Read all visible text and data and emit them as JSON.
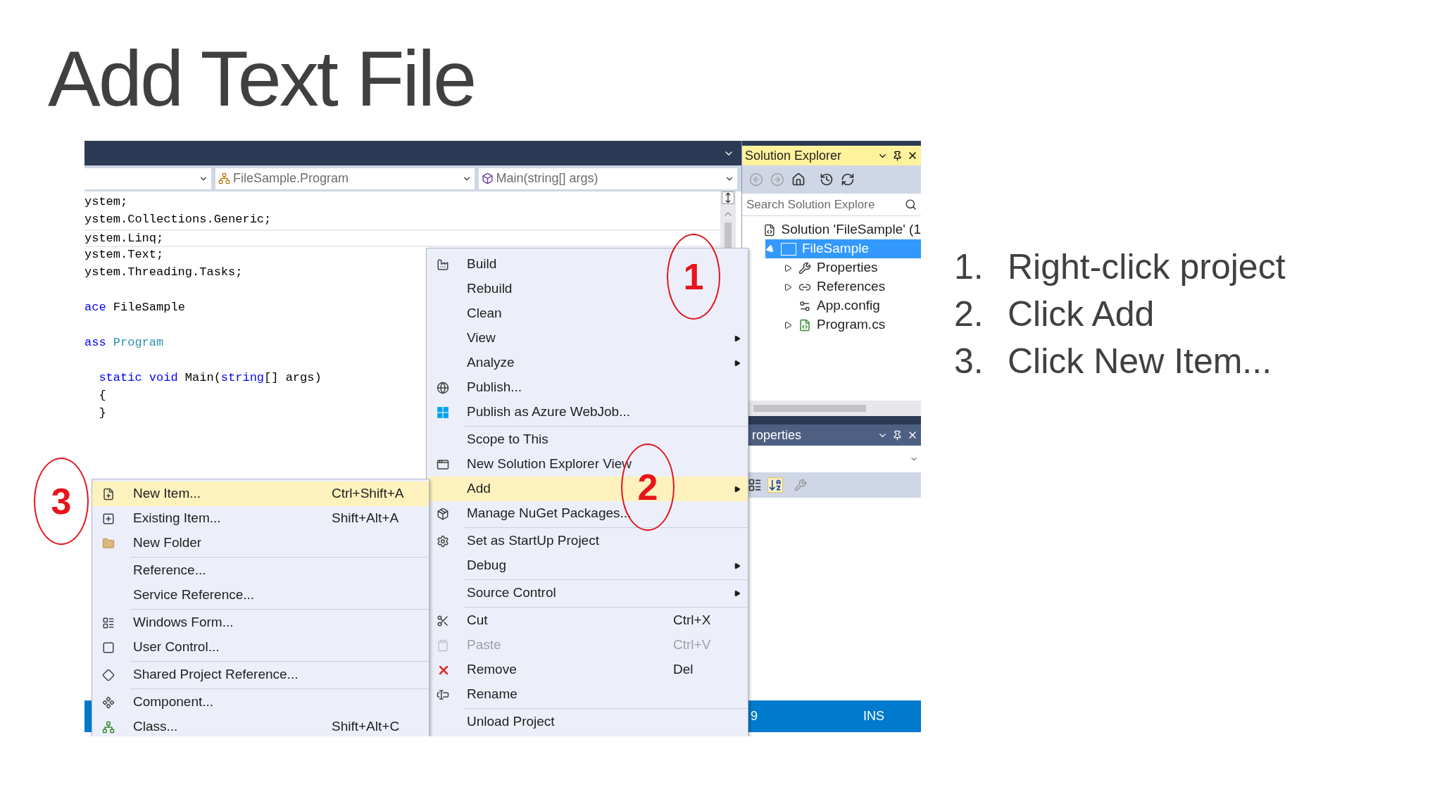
{
  "slide": {
    "title": "Add Text File",
    "steps": [
      {
        "number": "1.",
        "text": "Right-click project"
      },
      {
        "number": "2.",
        "text": "Click Add"
      },
      {
        "number": "3.",
        "text": "Click New Item..."
      }
    ]
  },
  "editor": {
    "dropdowns": [
      {
        "text": "FileSample.Program"
      },
      {
        "text": "Main(string[] args)"
      }
    ],
    "code_lines": [
      {
        "gap_before": false,
        "current": false,
        "tokens": [
          {
            "text": "ystem;",
            "kind": "plain"
          }
        ]
      },
      {
        "gap_before": false,
        "current": false,
        "tokens": [
          {
            "text": "ystem.Collections.Generic;",
            "kind": "plain"
          }
        ]
      },
      {
        "gap_before": false,
        "current": true,
        "tokens": [
          {
            "text": "ystem.Linq;",
            "kind": "plain"
          }
        ]
      },
      {
        "gap_before": false,
        "current": false,
        "tokens": [
          {
            "text": "ystem.Text;",
            "kind": "plain"
          }
        ]
      },
      {
        "gap_before": false,
        "current": false,
        "tokens": [
          {
            "text": "ystem.Threading.Tasks;",
            "kind": "plain"
          }
        ]
      },
      {
        "gap_before": true,
        "current": false,
        "tokens": [
          {
            "text": "ace",
            "kind": "keyword"
          },
          {
            "text": " FileSample",
            "kind": "plain"
          }
        ]
      },
      {
        "gap_before": true,
        "current": false,
        "tokens": [
          {
            "text": "ass",
            "kind": "keyword"
          },
          {
            "text": " Program",
            "kind": "type"
          }
        ]
      },
      {
        "gap_before": true,
        "current": false,
        "tokens": [
          {
            "text": "  static void",
            "kind": "keyword"
          },
          {
            "text": " Main(",
            "kind": "plain"
          },
          {
            "text": "string",
            "kind": "keyword"
          },
          {
            "text": "[] args)",
            "kind": "plain"
          }
        ]
      },
      {
        "gap_before": false,
        "current": false,
        "tokens": [
          {
            "text": "  {",
            "kind": "plain"
          }
        ]
      },
      {
        "gap_before": false,
        "current": false,
        "tokens": [
          {
            "text": "  }",
            "kind": "plain"
          }
        ]
      }
    ]
  },
  "solution_explorer": {
    "title": "Solution Explorer",
    "search": {
      "placeholder": "Search Solution Explore"
    },
    "tree": [
      {
        "label": "Solution 'FileSample' (1",
        "selected": false,
        "children": [
          {
            "label": "FileSample",
            "kind": "expandable",
            "expanded": true,
            "selected": true,
            "children": [
              {
                "label": "Properties",
                "kind": "expandable",
                "expanded": false,
                "selected": false
              },
              {
                "label": "References",
                "kind": "expandable",
                "expanded": false,
                "selected": false
              },
              {
                "label": "App.config",
                "kind": "leaf",
                "selected": false
              },
              {
                "label": "Program.cs",
                "kind": "expandable",
                "expanded": false,
                "selected": false
              }
            ]
          }
        ]
      }
    ]
  },
  "properties_panel": {
    "title": "roperties"
  },
  "status_bar": {
    "column": "9",
    "mode": "INS"
  },
  "context_menu": {
    "items": [
      {
        "kind": "item",
        "label": "Build",
        "submenu": false,
        "selected": false,
        "disabled": false
      },
      {
        "kind": "item",
        "label": "Rebuild",
        "submenu": false,
        "selected": false,
        "disabled": false
      },
      {
        "kind": "item",
        "label": "Clean",
        "submenu": false,
        "selected": false,
        "disabled": false
      },
      {
        "kind": "item",
        "label": "View",
        "submenu": true,
        "selected": false,
        "disabled": false
      },
      {
        "kind": "item",
        "label": "Analyze",
        "submenu": true,
        "selected": false,
        "disabled": false
      },
      {
        "kind": "item",
        "label": "Publish...",
        "submenu": false,
        "selected": false,
        "disabled": false
      },
      {
        "kind": "item",
        "label": "Publish as Azure WebJob...",
        "submenu": false,
        "selected": false,
        "disabled": false
      },
      {
        "kind": "separator"
      },
      {
        "kind": "item",
        "label": "Scope to This",
        "submenu": false,
        "selected": false,
        "disabled": false
      },
      {
        "kind": "item",
        "label": "New Solution Explorer View",
        "submenu": false,
        "selected": false,
        "disabled": false
      },
      {
        "kind": "item",
        "label": "Add",
        "submenu": true,
        "selected": true,
        "disabled": false
      },
      {
        "kind": "item",
        "label": "Manage NuGet Packages...",
        "submenu": false,
        "selected": false,
        "disabled": false
      },
      {
        "kind": "separator"
      },
      {
        "kind": "item",
        "label": "Set as StartUp Project",
        "submenu": false,
        "selected": false,
        "disabled": false
      },
      {
        "kind": "item",
        "label": "Debug",
        "submenu": true,
        "selected": false,
        "disabled": false
      },
      {
        "kind": "separator"
      },
      {
        "kind": "item",
        "label": "Source Control",
        "submenu": true,
        "selected": false,
        "disabled": false
      },
      {
        "kind": "separator"
      },
      {
        "kind": "item",
        "label": "Cut",
        "shortcut": "Ctrl+X",
        "submenu": false,
        "selected": false,
        "disabled": false
      },
      {
        "kind": "item",
        "label": "Paste",
        "shortcut": "Ctrl+V",
        "submenu": false,
        "selected": false,
        "disabled": true
      },
      {
        "kind": "item",
        "label": "Remove",
        "shortcut": "Del",
        "submenu": false,
        "selected": false,
        "disabled": false
      },
      {
        "kind": "item",
        "label": "Rename",
        "submenu": false,
        "selected": false,
        "disabled": false
      },
      {
        "kind": "separator"
      },
      {
        "kind": "item",
        "label": "Unload Project",
        "submenu": false,
        "selected": false,
        "disabled": false
      }
    ]
  },
  "add_submenu": {
    "items": [
      {
        "kind": "item",
        "label": "New Item...",
        "shortcut": "Ctrl+Shift+A",
        "selected": true
      },
      {
        "kind": "item",
        "label": "Existing Item...",
        "shortcut": "Shift+Alt+A",
        "selected": false
      },
      {
        "kind": "item",
        "label": "New Folder",
        "selected": false
      },
      {
        "kind": "separator"
      },
      {
        "kind": "item",
        "label": "Reference...",
        "selected": false
      },
      {
        "kind": "item",
        "label": "Service Reference...",
        "selected": false
      },
      {
        "kind": "separator"
      },
      {
        "kind": "item",
        "label": "Windows Form...",
        "selected": false
      },
      {
        "kind": "item",
        "label": "User Control...",
        "selected": false
      },
      {
        "kind": "separator"
      },
      {
        "kind": "item",
        "label": "Shared Project Reference...",
        "selected": false
      },
      {
        "kind": "separator"
      },
      {
        "kind": "item",
        "label": "Component...",
        "selected": false
      },
      {
        "kind": "item",
        "label": "Class...",
        "shortcut": "Shift+Alt+C",
        "selected": false
      }
    ]
  },
  "annotations": [
    {
      "number": "1"
    },
    {
      "number": "2"
    },
    {
      "number": "3"
    }
  ]
}
